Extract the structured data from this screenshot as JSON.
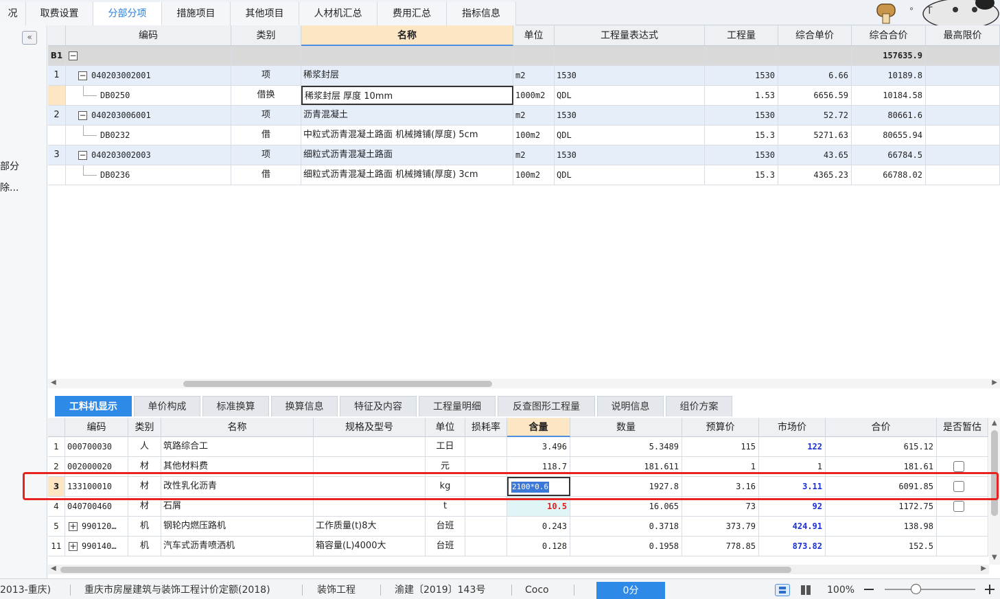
{
  "top_tabs": [
    "况",
    "取费设置",
    "分部分项",
    "措施项目",
    "其他项目",
    "人材机汇总",
    "费用汇总",
    "指标信息"
  ],
  "sidebar": {
    "collapse_label": "«",
    "text1": "部分",
    "text2": "除..."
  },
  "upper_headers": [
    "编码",
    "类别",
    "名称",
    "单位",
    "工程量表达式",
    "工程量",
    "综合单价",
    "综合合价",
    "最高限价"
  ],
  "upper_rows": [
    {
      "num": "B1",
      "code": "",
      "type": "",
      "name": "",
      "unit": "",
      "expr": "",
      "qty": "",
      "uprice": "",
      "total": "157635.9",
      "kind": "gray",
      "toggle": "−"
    },
    {
      "num": "1",
      "code": "040203002001",
      "type": "项",
      "name": "稀浆封层",
      "unit": "m2",
      "expr": "1530",
      "qty": "1530",
      "uprice": "6.66",
      "total": "10189.8",
      "kind": "blue",
      "toggle": "−"
    },
    {
      "num": "",
      "code": "DB0250",
      "type": "借换",
      "name": "稀浆封层 厚度 10mm",
      "unit": "1000m2",
      "expr": "QDL",
      "qty": "1.53",
      "uprice": "6656.59",
      "total": "10184.58",
      "kind": "white"
    },
    {
      "num": "2",
      "code": "040203006001",
      "type": "项",
      "name": "沥青混凝土",
      "unit": "m2",
      "expr": "1530",
      "qty": "1530",
      "uprice": "52.72",
      "total": "80661.6",
      "kind": "blue",
      "toggle": "−"
    },
    {
      "num": "",
      "code": "DB0232",
      "type": "借",
      "name": "中粒式沥青混凝土路面 机械摊铺(厚度) 5cm",
      "unit": "100m2",
      "expr": "QDL",
      "qty": "15.3",
      "uprice": "5271.63",
      "total": "80655.94",
      "kind": "white"
    },
    {
      "num": "3",
      "code": "040203002003",
      "type": "项",
      "name": "细粒式沥青混凝土路面",
      "unit": "m2",
      "expr": "1530",
      "qty": "1530",
      "uprice": "43.65",
      "total": "66784.5",
      "kind": "blue",
      "toggle": "−"
    },
    {
      "num": "",
      "code": "DB0236",
      "type": "借",
      "name": "细粒式沥青混凝土路面 机械摊铺(厚度) 3cm",
      "unit": "100m2",
      "expr": "QDL",
      "qty": "15.3",
      "uprice": "4365.23",
      "total": "66788.02",
      "kind": "white"
    }
  ],
  "bottom_tabs": [
    "工料机显示",
    "单价构成",
    "标准换算",
    "换算信息",
    "特征及内容",
    "工程量明细",
    "反查图形工程量",
    "说明信息",
    "组价方案"
  ],
  "lower_headers": [
    "编码",
    "类别",
    "名称",
    "规格及型号",
    "单位",
    "损耗率",
    "含量",
    "数量",
    "预算价",
    "市场价",
    "合价",
    "是否暂估"
  ],
  "lower_rows": [
    {
      "num": "1",
      "code": "000700030",
      "type": "人",
      "name": "筑路综合工",
      "spec": "",
      "unit": "工日",
      "loss": "",
      "content": "3.496",
      "qty": "5.3489",
      "budget": "115",
      "market": "122",
      "total": "615.12",
      "check": false,
      "expand": false
    },
    {
      "num": "2",
      "code": "002000020",
      "type": "材",
      "name": "其他材料费",
      "spec": "",
      "unit": "元",
      "loss": "",
      "content": "118.7",
      "qty": "181.611",
      "budget": "1",
      "market": "1",
      "total": "181.61",
      "check": true,
      "expand": false
    },
    {
      "num": "3",
      "code": "133100010",
      "type": "材",
      "name": "改性乳化沥青",
      "spec": "",
      "unit": "kg",
      "loss": "",
      "content": "2100*0.6",
      "qty": "1927.8",
      "budget": "3.16",
      "market": "3.11",
      "total": "6091.85",
      "check": true,
      "expand": false
    },
    {
      "num": "4",
      "code": "040700460",
      "type": "材",
      "name": "石屑",
      "spec": "",
      "unit": "t",
      "loss": "",
      "content": "10.5",
      "qty": "16.065",
      "budget": "73",
      "market": "92",
      "total": "1172.75",
      "check": true,
      "expand": false
    },
    {
      "num": "5",
      "code": "990120…",
      "type": "机",
      "name": "钢轮内燃压路机",
      "spec": "工作质量(t)8大",
      "unit": "台班",
      "loss": "",
      "content": "0.243",
      "qty": "0.3718",
      "budget": "373.79",
      "market": "424.91",
      "total": "138.98",
      "check": false,
      "expand": true
    },
    {
      "num": "11",
      "code": "990140…",
      "type": "机",
      "name": "汽车式沥青喷洒机",
      "spec": "箱容量(L)4000大",
      "unit": "台班",
      "loss": "",
      "content": "0.128",
      "qty": "0.1958",
      "budget": "778.85",
      "market": "873.82",
      "total": "152.5",
      "check": false,
      "expand": true
    }
  ],
  "status": [
    "2013-重庆)",
    "重庆市房屋建筑与装饰工程计价定额(2018)",
    "装饰工程",
    "渝建〔2019〕143号",
    "Coco",
    "0分",
    "100%"
  ],
  "colors": {
    "accent": "#2e8ae6",
    "highlight_box": "#e8231f",
    "market_price": "#1a2fd4"
  }
}
